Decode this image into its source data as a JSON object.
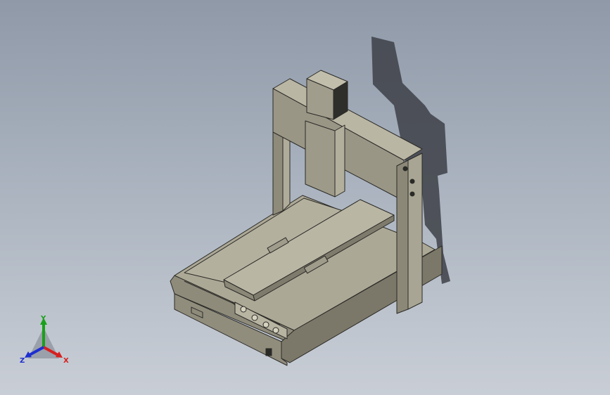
{
  "viewport": {
    "background_top": "#8f99a8",
    "background_bottom": "#c9ced6",
    "model_color": "#a7a392",
    "model_edge_color": "#2a2a26",
    "shadow_color": "#3a3c40"
  },
  "triad": {
    "x_label": "X",
    "y_label": "Y",
    "z_label": "Z",
    "x_color": "#d62020",
    "y_color": "#1aa01a",
    "z_color": "#1e2fd0"
  }
}
